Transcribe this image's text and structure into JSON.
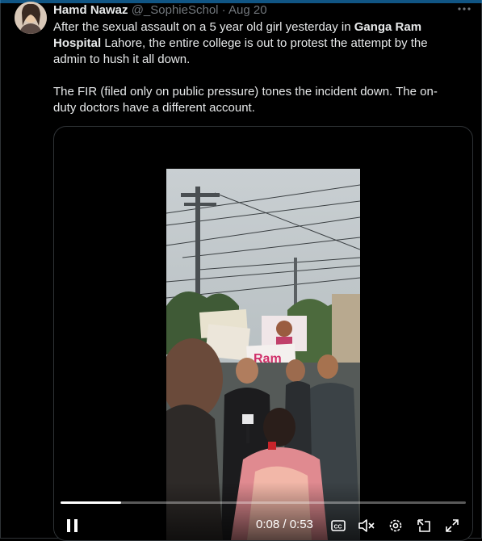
{
  "tweet": {
    "author_name": "Hamd Nawaz",
    "handle_time": "@_SophieSchol · Aug 20",
    "para1": [
      {
        "text": "After the sexual assault on a 5 year old girl yesterday in ",
        "bold": false
      },
      {
        "text": "Ganga Ram Hospital",
        "bold": true
      },
      {
        "text": " Lahore, the entire college is out to protest the attempt by the admin to hush it all down.",
        "bold": false
      }
    ],
    "para2": "The FIR (filed only on public pressure) tones the incident down. The on-duty doctors have a different account."
  },
  "video": {
    "progress": 0.15,
    "time_display": "0:08 / 0:53",
    "sign_text": "Ram"
  },
  "icons": {
    "more": "more-icon",
    "pause": "pause-icon",
    "captions": "captions-icon",
    "mute": "mute-icon",
    "settings": "settings-icon",
    "pip": "pip-icon",
    "fullscreen": "fullscreen-icon"
  },
  "colors": {
    "text": "#e7e9ea",
    "muted": "#71767b",
    "accent": "#1d9bf0",
    "border": "#2f3336"
  }
}
